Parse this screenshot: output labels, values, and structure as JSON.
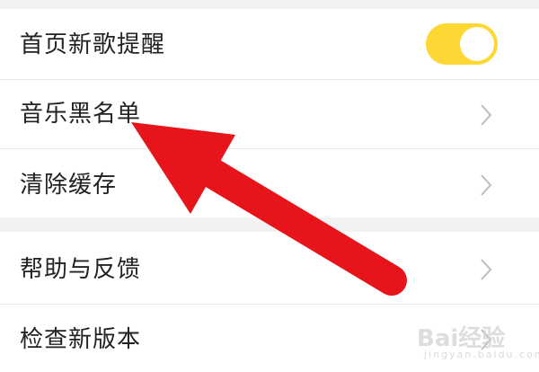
{
  "settings": {
    "items": [
      {
        "label": "首页新歌提醒",
        "type": "toggle",
        "toggle_on": true
      },
      {
        "label": "音乐黑名单",
        "type": "link"
      },
      {
        "label": "清除缓存",
        "type": "link"
      },
      {
        "label": "帮助与反馈",
        "type": "link"
      },
      {
        "label": "检查新版本",
        "type": "link"
      }
    ]
  },
  "colors": {
    "toggle_on": "#fdd835",
    "arrow": "#e8141b",
    "chevron": "#bdbdbd"
  },
  "icons": {
    "chevron": "chevron-right-icon",
    "annotation": "red-arrow-icon"
  },
  "watermark": {
    "text": "Bai经验",
    "sub": "jingyan.baidu.com"
  }
}
